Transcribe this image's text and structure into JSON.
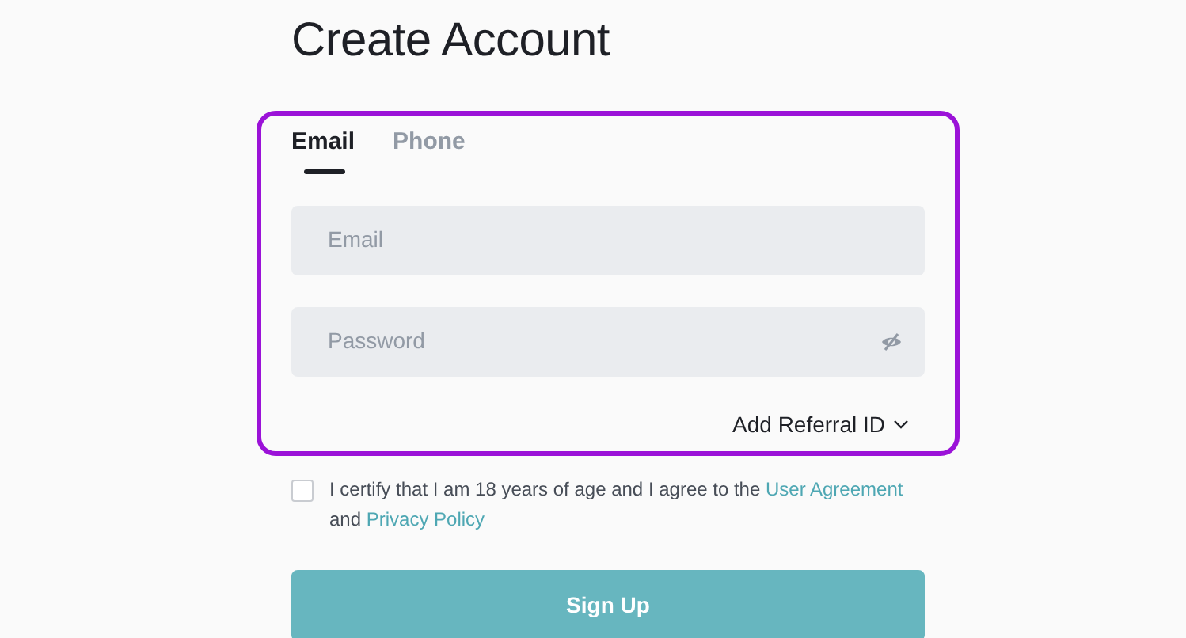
{
  "title": "Create Account",
  "tabs": [
    {
      "label": "Email",
      "selected": true
    },
    {
      "label": "Phone",
      "selected": false
    }
  ],
  "fields": [
    {
      "placeholder": "Email",
      "kind": "text"
    },
    {
      "placeholder": "Password",
      "kind": "password"
    }
  ],
  "referral": {
    "label": "Add Referral ID",
    "expanded": false
  },
  "agreement": {
    "checked": false,
    "parts": [
      {
        "kind": "text",
        "text": "I certify that I am 18 years of age and I agree to the"
      },
      {
        "kind": "link",
        "text": "User Agreement"
      },
      {
        "kind": "text",
        "text": "and"
      },
      {
        "kind": "link",
        "text": "Privacy Policy"
      }
    ]
  },
  "submit": {
    "label": "Sign Up",
    "disabled": true
  }
}
